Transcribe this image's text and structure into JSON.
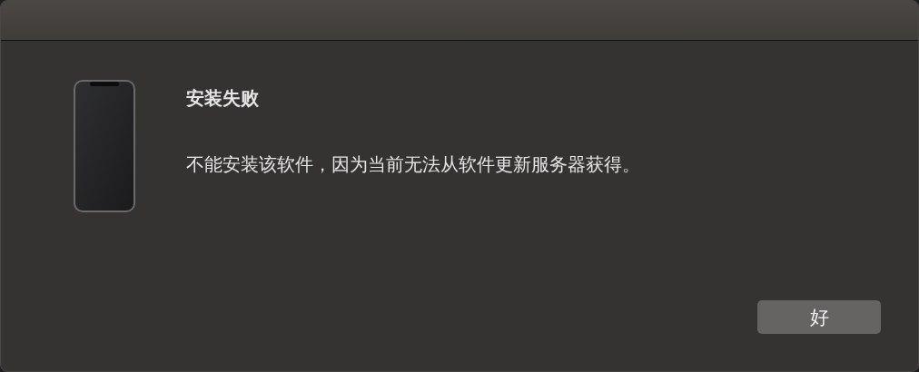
{
  "dialog": {
    "title": "安装失败",
    "message": "不能安装该软件，因为当前无法从软件更新服务器获得。"
  },
  "buttons": [
    {
      "label": "好"
    }
  ]
}
